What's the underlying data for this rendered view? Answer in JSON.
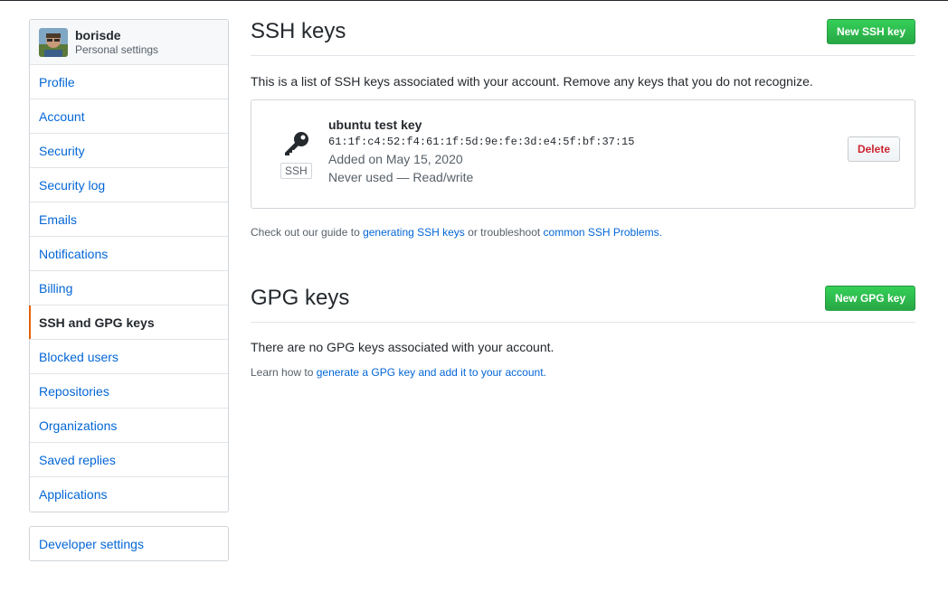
{
  "sidebar": {
    "username": "borisde",
    "subtitle": "Personal settings",
    "items": [
      {
        "label": "Profile"
      },
      {
        "label": "Account"
      },
      {
        "label": "Security"
      },
      {
        "label": "Security log"
      },
      {
        "label": "Emails"
      },
      {
        "label": "Notifications"
      },
      {
        "label": "Billing"
      },
      {
        "label": "SSH and GPG keys",
        "selected": true
      },
      {
        "label": "Blocked users"
      },
      {
        "label": "Repositories"
      },
      {
        "label": "Organizations"
      },
      {
        "label": "Saved replies"
      },
      {
        "label": "Applications"
      }
    ],
    "developer_settings": "Developer settings"
  },
  "ssh": {
    "title": "SSH keys",
    "new_button": "New SSH key",
    "description": "This is a list of SSH keys associated with your account. Remove any keys that you do not recognize.",
    "key": {
      "type_label": "SSH",
      "name": "ubuntu test key",
      "fingerprint": "61:1f:c4:52:f4:61:1f:5d:9e:fe:3d:e4:5f:bf:37:15",
      "added": "Added on May 15, 2020",
      "usage": "Never used — Read/write",
      "delete_label": "Delete"
    },
    "note_prefix": "Check out our guide to ",
    "note_link1": "generating SSH keys",
    "note_middle": " or troubleshoot ",
    "note_link2": "common SSH Problems."
  },
  "gpg": {
    "title": "GPG keys",
    "new_button": "New GPG key",
    "description": "There are no GPG keys associated with your account.",
    "note_prefix": "Learn how to ",
    "note_link": "generate a GPG key and add it to your account."
  },
  "colors": {
    "accent": "#e36209",
    "link": "#0366d6",
    "primary_button": "#28a745",
    "danger": "#cb2431"
  }
}
